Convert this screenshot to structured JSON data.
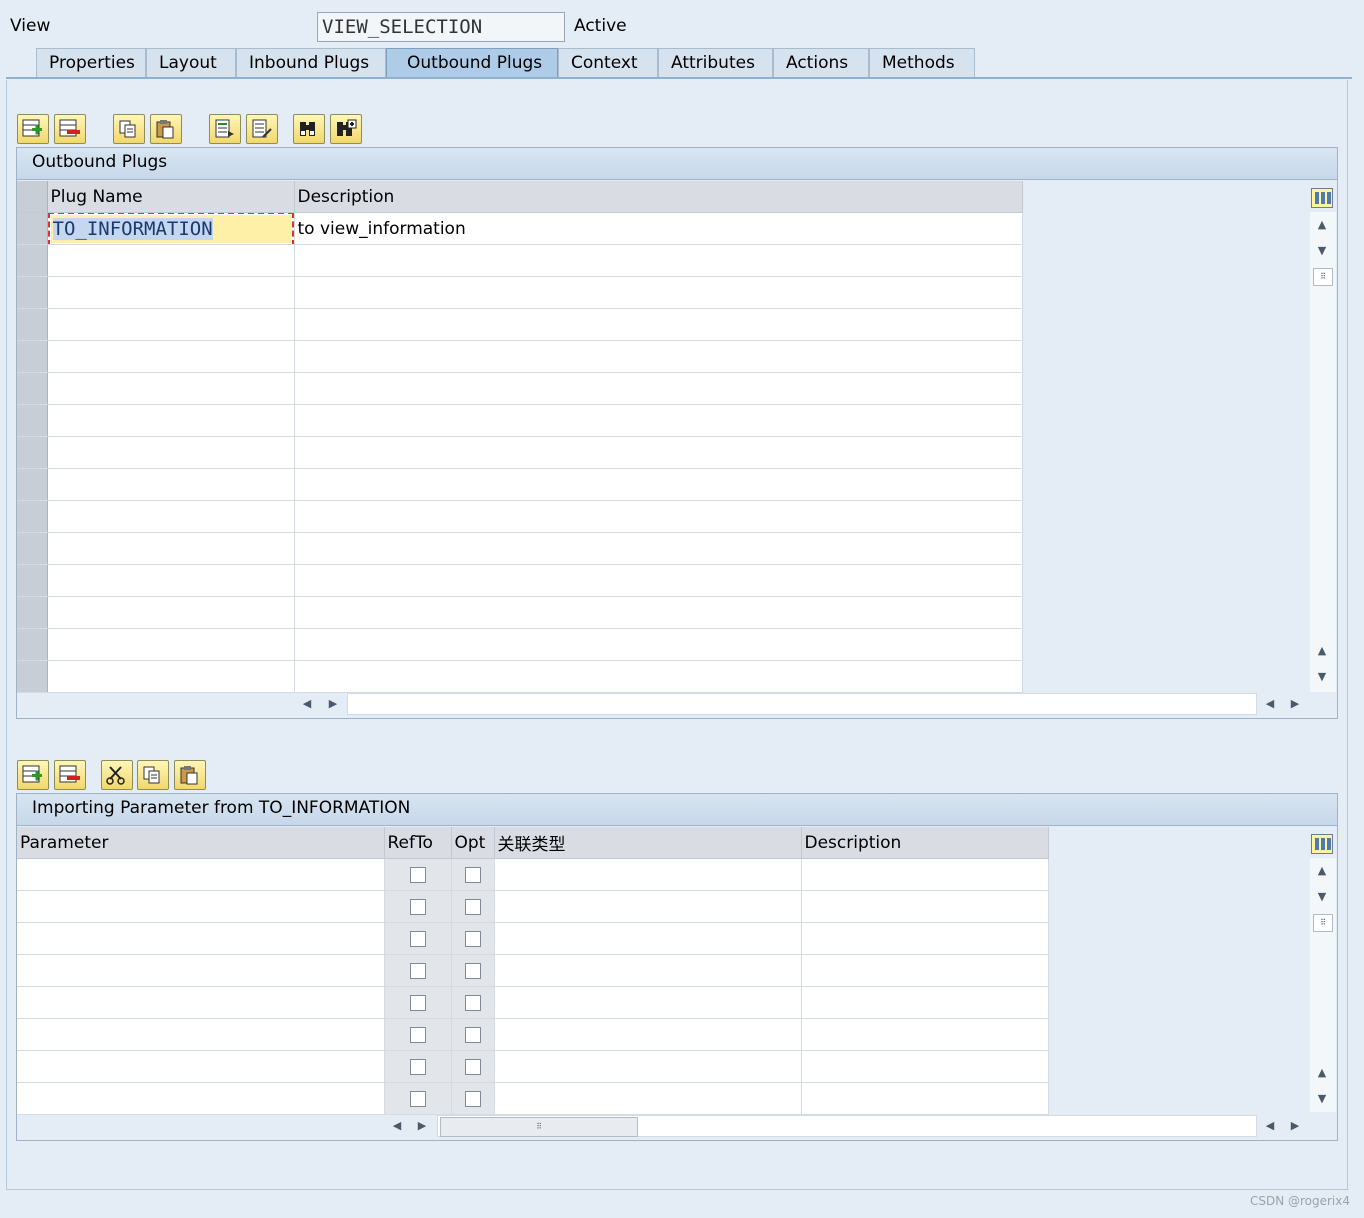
{
  "header": {
    "label": "View",
    "view_name": "VIEW_SELECTION",
    "status": "Active"
  },
  "tabs": [
    {
      "label": "Properties",
      "active": false
    },
    {
      "label": "Layout",
      "active": false
    },
    {
      "label": "Inbound Plugs",
      "active": false
    },
    {
      "label": "Outbound Plugs",
      "active": true
    },
    {
      "label": "Context",
      "active": false
    },
    {
      "label": "Attributes",
      "active": false
    },
    {
      "label": "Actions",
      "active": false
    },
    {
      "label": "Methods",
      "active": false
    }
  ],
  "outbound_panel": {
    "title": "Outbound Plugs",
    "columns": [
      "Plug Name",
      "Description"
    ],
    "rows": [
      {
        "plug_name": "TO_INFORMATION",
        "description": "to view_information"
      }
    ],
    "total_rows": 15
  },
  "params_panel": {
    "title": "Importing Parameter from TO_INFORMATION",
    "columns": [
      "Parameter",
      "RefTo",
      "Opt",
      "关联类型",
      "Description"
    ],
    "total_rows": 8
  },
  "toolbar_icons": {
    "top": [
      "insert-row-icon",
      "delete-row-icon",
      "copy-icon",
      "paste-icon",
      "details-icon",
      "details-edit-icon",
      "find-icon",
      "find-next-icon"
    ],
    "bottom": [
      "insert-row-icon",
      "delete-row-icon",
      "cut-icon",
      "copy-icon",
      "paste-icon"
    ]
  },
  "watermark": "CSDN @rogerix4",
  "colors": {
    "background": "#e4edf6",
    "active_tab": "#aecbe8",
    "edit_cell": "#fff0a8"
  }
}
